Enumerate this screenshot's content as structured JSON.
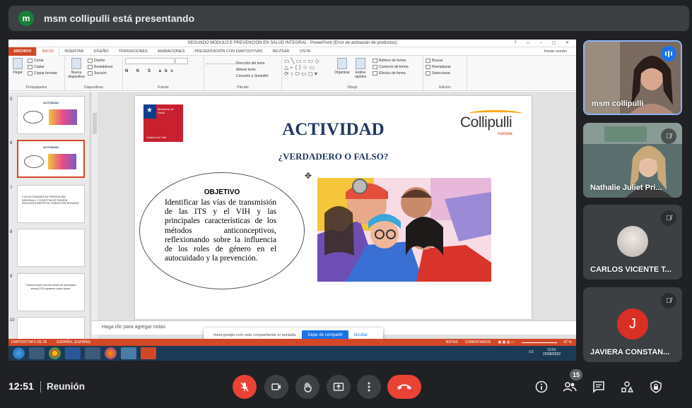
{
  "presenter_bar": {
    "avatar_letter": "m",
    "text": "msm collipulli está presentando"
  },
  "powerpoint": {
    "title": "SEGUNDO MÓDULO E PREVENCIÓN EN SALUD INTEGRAL - PowerPoint (Error de activación de productos)",
    "login": "Iniciar sesión",
    "tabs": [
      "ARCHIVO",
      "INICIO",
      "INSERTAR",
      "DISEÑO",
      "TRANSICIONES",
      "ANIMACIONES",
      "PRESENTACIÓN CON DIAPOSITIVAS",
      "REVISAR",
      "VISTA"
    ],
    "ribbon": {
      "clipboard": {
        "paste": "Pegar",
        "cut": "Cortar",
        "copy": "Copiar",
        "format": "Copiar formato",
        "label": "Portapapeles"
      },
      "slides": {
        "new": "Nueva diapositiva",
        "design": "Diseño",
        "reset": "Restablecer",
        "section": "Sección",
        "label": "Diapositivas"
      },
      "font_label": "Fuente",
      "paragraph": {
        "direction": "Dirección del texto",
        "align": "Alinear texto",
        "smartart": "Convertir a SmartArt",
        "label": "Párrafo"
      },
      "drawing": {
        "organize": "Organizar",
        "styles": "Estilos rápidos",
        "fill": "Relleno de forma",
        "outline": "Contorno de forma",
        "effects": "Efectos de forma",
        "label": "Dibujo"
      },
      "editing": {
        "find": "Buscar",
        "replace": "Reemplazar",
        "select": "Seleccionar",
        "label": "Edición"
      }
    },
    "thumbnails": [
      {
        "num": "5",
        "title": "ACTIVIDAD",
        "text": ""
      },
      {
        "num": "6",
        "title": "ACTIVIDAD",
        "text": ""
      },
      {
        "num": "7",
        "title": "",
        "text": "\"LAS ACTIVIDADES DE PREVENCIÓN INDIVIDUAL Y COLECTIVA SE PUEDEN REALIZAR A PARTIR DE CONDUCTAS SEGURAS\""
      },
      {
        "num": "8",
        "title": "",
        "text": ""
      },
      {
        "num": "9",
        "title": "",
        "text": "\"Usted prevenir las infecciones de transmisión sexual (ITS) siguiendo cuatro pasos\""
      },
      {
        "num": "10",
        "title": "",
        "text": ""
      }
    ],
    "slide": {
      "title": "ACTIVIDAD",
      "subtitle": "¿VERDADERO O FALSO?",
      "objective_heading": "OBJETIVO",
      "objective_text": "Identificar las vías de transmisión de las ITS y el VIH y las principales características de los métodos anticonceptivos, reflexionando sobre la influencia de los roles de género en el autocuidado y la prevención.",
      "gob_logo_text": "Ministerio de Salud",
      "gob_logo_caption": "Gobierno de Chile",
      "brand": "Collipulli",
      "brand_sub": "+comuna"
    },
    "notes_placeholder": "Haga clic para agregar notas",
    "status": {
      "slide": "DIAPOSITIVA 6 DE 28",
      "lang": "ESPAÑOL (ESPAÑA)",
      "notes": "NOTAS",
      "comments": "COMENTARIOS",
      "zoom": "67 %"
    },
    "taskbar": {
      "lang": "ES",
      "time": "12:51",
      "date": "22/08/2022"
    }
  },
  "share_notice": {
    "text": "meet.google.com está compartiendo tu pantalla.",
    "stop": "Dejar de compartir",
    "hide": "Ocultar"
  },
  "participants": [
    {
      "name": "msm collipulli",
      "state": "speaking"
    },
    {
      "name": "Nathalie Juliet Pri...",
      "state": "muted"
    },
    {
      "name": "CARLOS VICENTE T...",
      "state": "muted"
    },
    {
      "name": "JAVIERA CONSTAN...",
      "state": "muted",
      "initial": "J"
    }
  ],
  "bottom": {
    "time": "12:51",
    "meeting": "Reunión",
    "people_count": "15"
  },
  "colors": {
    "accent_red": "#ea4335",
    "ppt_orange": "#d24726",
    "meet_blue": "#1a73e8",
    "slide_navy": "#1f3864"
  }
}
